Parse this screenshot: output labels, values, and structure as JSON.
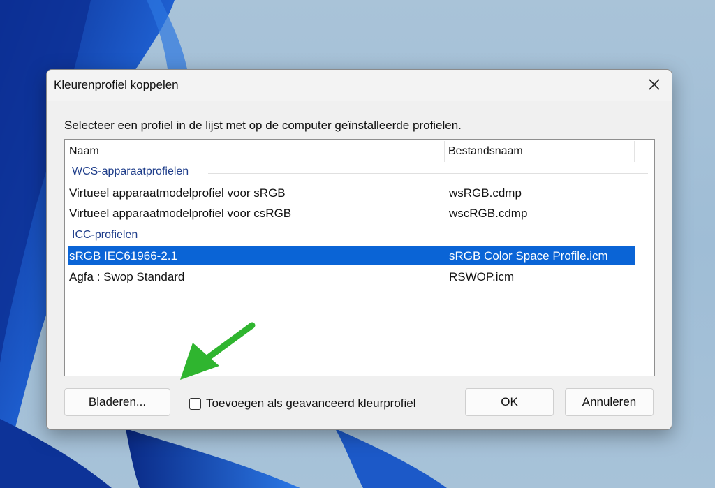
{
  "colors": {
    "accent": "#0a64d6",
    "group_label": "#1e3d8a",
    "arrow": "#2fb52f"
  },
  "dialog": {
    "title": "Kleurenprofiel koppelen",
    "close_icon": "close-icon",
    "instruction": "Selecteer een profiel in de lijst met op de computer geïnstalleerde profielen."
  },
  "list": {
    "columns": [
      "Naam",
      "Bestandsnaam"
    ],
    "groups": [
      {
        "label": "WCS-apparaatprofielen",
        "rows": [
          {
            "name": "Virtueel apparaatmodelprofiel voor sRGB",
            "file": "wsRGB.cdmp",
            "selected": false
          },
          {
            "name": "Virtueel apparaatmodelprofiel voor csRGB",
            "file": "wscRGB.cdmp",
            "selected": false
          }
        ]
      },
      {
        "label": "ICC-profielen",
        "rows": [
          {
            "name": "sRGB IEC61966-2.1",
            "file": "sRGB Color Space Profile.icm",
            "selected": true
          },
          {
            "name": "Agfa : Swop Standard",
            "file": "RSWOP.icm",
            "selected": false
          }
        ]
      }
    ]
  },
  "footer": {
    "browse_label": "Bladeren...",
    "advanced_checkbox_label": "Toevoegen als geavanceerd kleurprofiel",
    "advanced_checked": false,
    "ok_label": "OK",
    "cancel_label": "Annuleren"
  }
}
